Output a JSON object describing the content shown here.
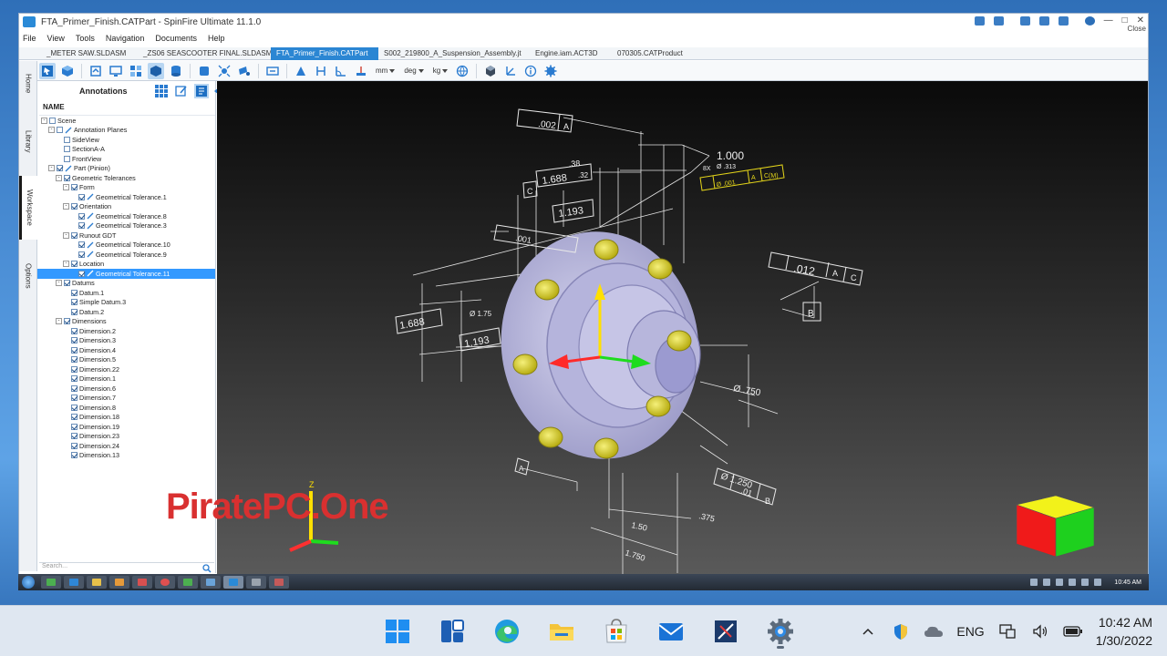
{
  "app": {
    "window_title": "FTA_Primer_Finish.CATPart - SpinFire Ultimate 11.1.0",
    "close_label": "Close",
    "menu": [
      "File",
      "View",
      "Tools",
      "Navigation",
      "Documents",
      "Help"
    ],
    "tabs": [
      {
        "label": "_METER SAW.SLDASM",
        "active": false
      },
      {
        "label": "_ZS06 SEASCOOTER FINAL.SLDASM",
        "active": false
      },
      {
        "label": "FTA_Primer_Finish.CATPart",
        "active": true
      },
      {
        "label": "S002_219800_A_Suspension_Assembly.jt",
        "active": false
      },
      {
        "label": "Engine.iam.ACT3D",
        "active": false
      },
      {
        "label": "070305.CATProduct",
        "active": false
      }
    ],
    "toolbar_units": {
      "length": "mm",
      "angle": "deg",
      "mass": "kg"
    },
    "side_tabs": [
      "Home",
      "Library",
      "Workspace",
      "Options"
    ],
    "panel": {
      "title": "Annotations",
      "column_header": "NAME",
      "search_placeholder": "Search..."
    },
    "tree": [
      {
        "label": "Scene",
        "level": 0,
        "exp": "-",
        "cb": false,
        "sel": false
      },
      {
        "label": "Annotation Planes",
        "level": 1,
        "exp": "-",
        "cb": false,
        "sel": false
      },
      {
        "label": "SideView",
        "level": 2,
        "exp": "",
        "cb": false,
        "sel": false
      },
      {
        "label": "SectionA-A",
        "level": 2,
        "exp": "",
        "cb": false,
        "sel": false
      },
      {
        "label": "FrontView",
        "level": 2,
        "exp": "",
        "cb": false,
        "sel": false
      },
      {
        "label": "Part (Pinion)",
        "level": 1,
        "exp": "-",
        "cb": true,
        "sel": false
      },
      {
        "label": "Geometric Tolerances",
        "level": 2,
        "exp": "-",
        "cb": true,
        "sel": false
      },
      {
        "label": "Form",
        "level": 3,
        "exp": "-",
        "cb": true,
        "sel": false
      },
      {
        "label": "Geometrical Tolerance.1",
        "level": 4,
        "exp": "",
        "cb": true,
        "sel": false
      },
      {
        "label": "Orientation",
        "level": 3,
        "exp": "-",
        "cb": true,
        "sel": false
      },
      {
        "label": "Geometrical Tolerance.8",
        "level": 4,
        "exp": "",
        "cb": true,
        "sel": false
      },
      {
        "label": "Geometrical Tolerance.3",
        "level": 4,
        "exp": "",
        "cb": true,
        "sel": false
      },
      {
        "label": "Runout GDT",
        "level": 3,
        "exp": "-",
        "cb": true,
        "sel": false
      },
      {
        "label": "Geometrical Tolerance.10",
        "level": 4,
        "exp": "",
        "cb": true,
        "sel": false
      },
      {
        "label": "Geometrical Tolerance.9",
        "level": 4,
        "exp": "",
        "cb": true,
        "sel": false
      },
      {
        "label": "Location",
        "level": 3,
        "exp": "-",
        "cb": true,
        "sel": false
      },
      {
        "label": "Geometrical Tolerance.11",
        "level": 4,
        "exp": "",
        "cb": true,
        "sel": true
      },
      {
        "label": "Datums",
        "level": 2,
        "exp": "-",
        "cb": true,
        "sel": false
      },
      {
        "label": "Datum.1",
        "level": 3,
        "exp": "",
        "cb": true,
        "sel": false
      },
      {
        "label": "Simple Datum.3",
        "level": 3,
        "exp": "",
        "cb": true,
        "sel": false
      },
      {
        "label": "Datum.2",
        "level": 3,
        "exp": "",
        "cb": true,
        "sel": false
      },
      {
        "label": "Dimensions",
        "level": 2,
        "exp": "-",
        "cb": true,
        "sel": false
      },
      {
        "label": "Dimension.2",
        "level": 3,
        "exp": "",
        "cb": true,
        "sel": false
      },
      {
        "label": "Dimension.3",
        "level": 3,
        "exp": "",
        "cb": true,
        "sel": false
      },
      {
        "label": "Dimension.4",
        "level": 3,
        "exp": "",
        "cb": true,
        "sel": false
      },
      {
        "label": "Dimension.5",
        "level": 3,
        "exp": "",
        "cb": true,
        "sel": false
      },
      {
        "label": "Dimension.22",
        "level": 3,
        "exp": "",
        "cb": true,
        "sel": false
      },
      {
        "label": "Dimension.1",
        "level": 3,
        "exp": "",
        "cb": true,
        "sel": false
      },
      {
        "label": "Dimension.6",
        "level": 3,
        "exp": "",
        "cb": true,
        "sel": false
      },
      {
        "label": "Dimension.7",
        "level": 3,
        "exp": "",
        "cb": true,
        "sel": false
      },
      {
        "label": "Dimension.8",
        "level": 3,
        "exp": "",
        "cb": true,
        "sel": false
      },
      {
        "label": "Dimension.18",
        "level": 3,
        "exp": "",
        "cb": true,
        "sel": false
      },
      {
        "label": "Dimension.19",
        "level": 3,
        "exp": "",
        "cb": true,
        "sel": false
      },
      {
        "label": "Dimension.23",
        "level": 3,
        "exp": "",
        "cb": true,
        "sel": false
      },
      {
        "label": "Dimension.24",
        "level": 3,
        "exp": "",
        "cb": true,
        "sel": false
      },
      {
        "label": "Dimension.13",
        "level": 3,
        "exp": "",
        "cb": true,
        "sel": false
      }
    ],
    "annotations": {
      "flatness": ".002",
      "flatness_datum": "A",
      "dim_1000": "1.000",
      "dim_38": ".38",
      "dim_1688_top": "1.688",
      "dim_32": ".32",
      "datum_c": "C",
      "dim_1193_top": "1.193",
      "perp": ".001",
      "pos_top": "8X",
      "pos_dia": "Ø .313",
      "pos_tol": "Ø .001",
      "pos_datums": [
        "A",
        "C(M)"
      ],
      "runout": ".012",
      "runout_datums": [
        "A",
        "C"
      ],
      "datum_b": "B",
      "dim_1688_left": "1.688",
      "dim_175": "Ø 1.75",
      "dim_1193_left": "1.193",
      "dim_750": "Ø .750",
      "dim_1250": "Ø 1.250",
      "dim_01": ".01",
      "dim_01_datum": "B",
      "datum_a": "A",
      "dim_150": "1.50",
      "dim_375": ".375",
      "dim_1750": "1.750",
      "axis_z": "Z"
    },
    "inner_tray_time": "10:45 AM"
  },
  "watermark": "PiratePC.One",
  "taskbar": {
    "language": "ENG",
    "time": "10:42 AM",
    "date": "1/30/2022"
  }
}
